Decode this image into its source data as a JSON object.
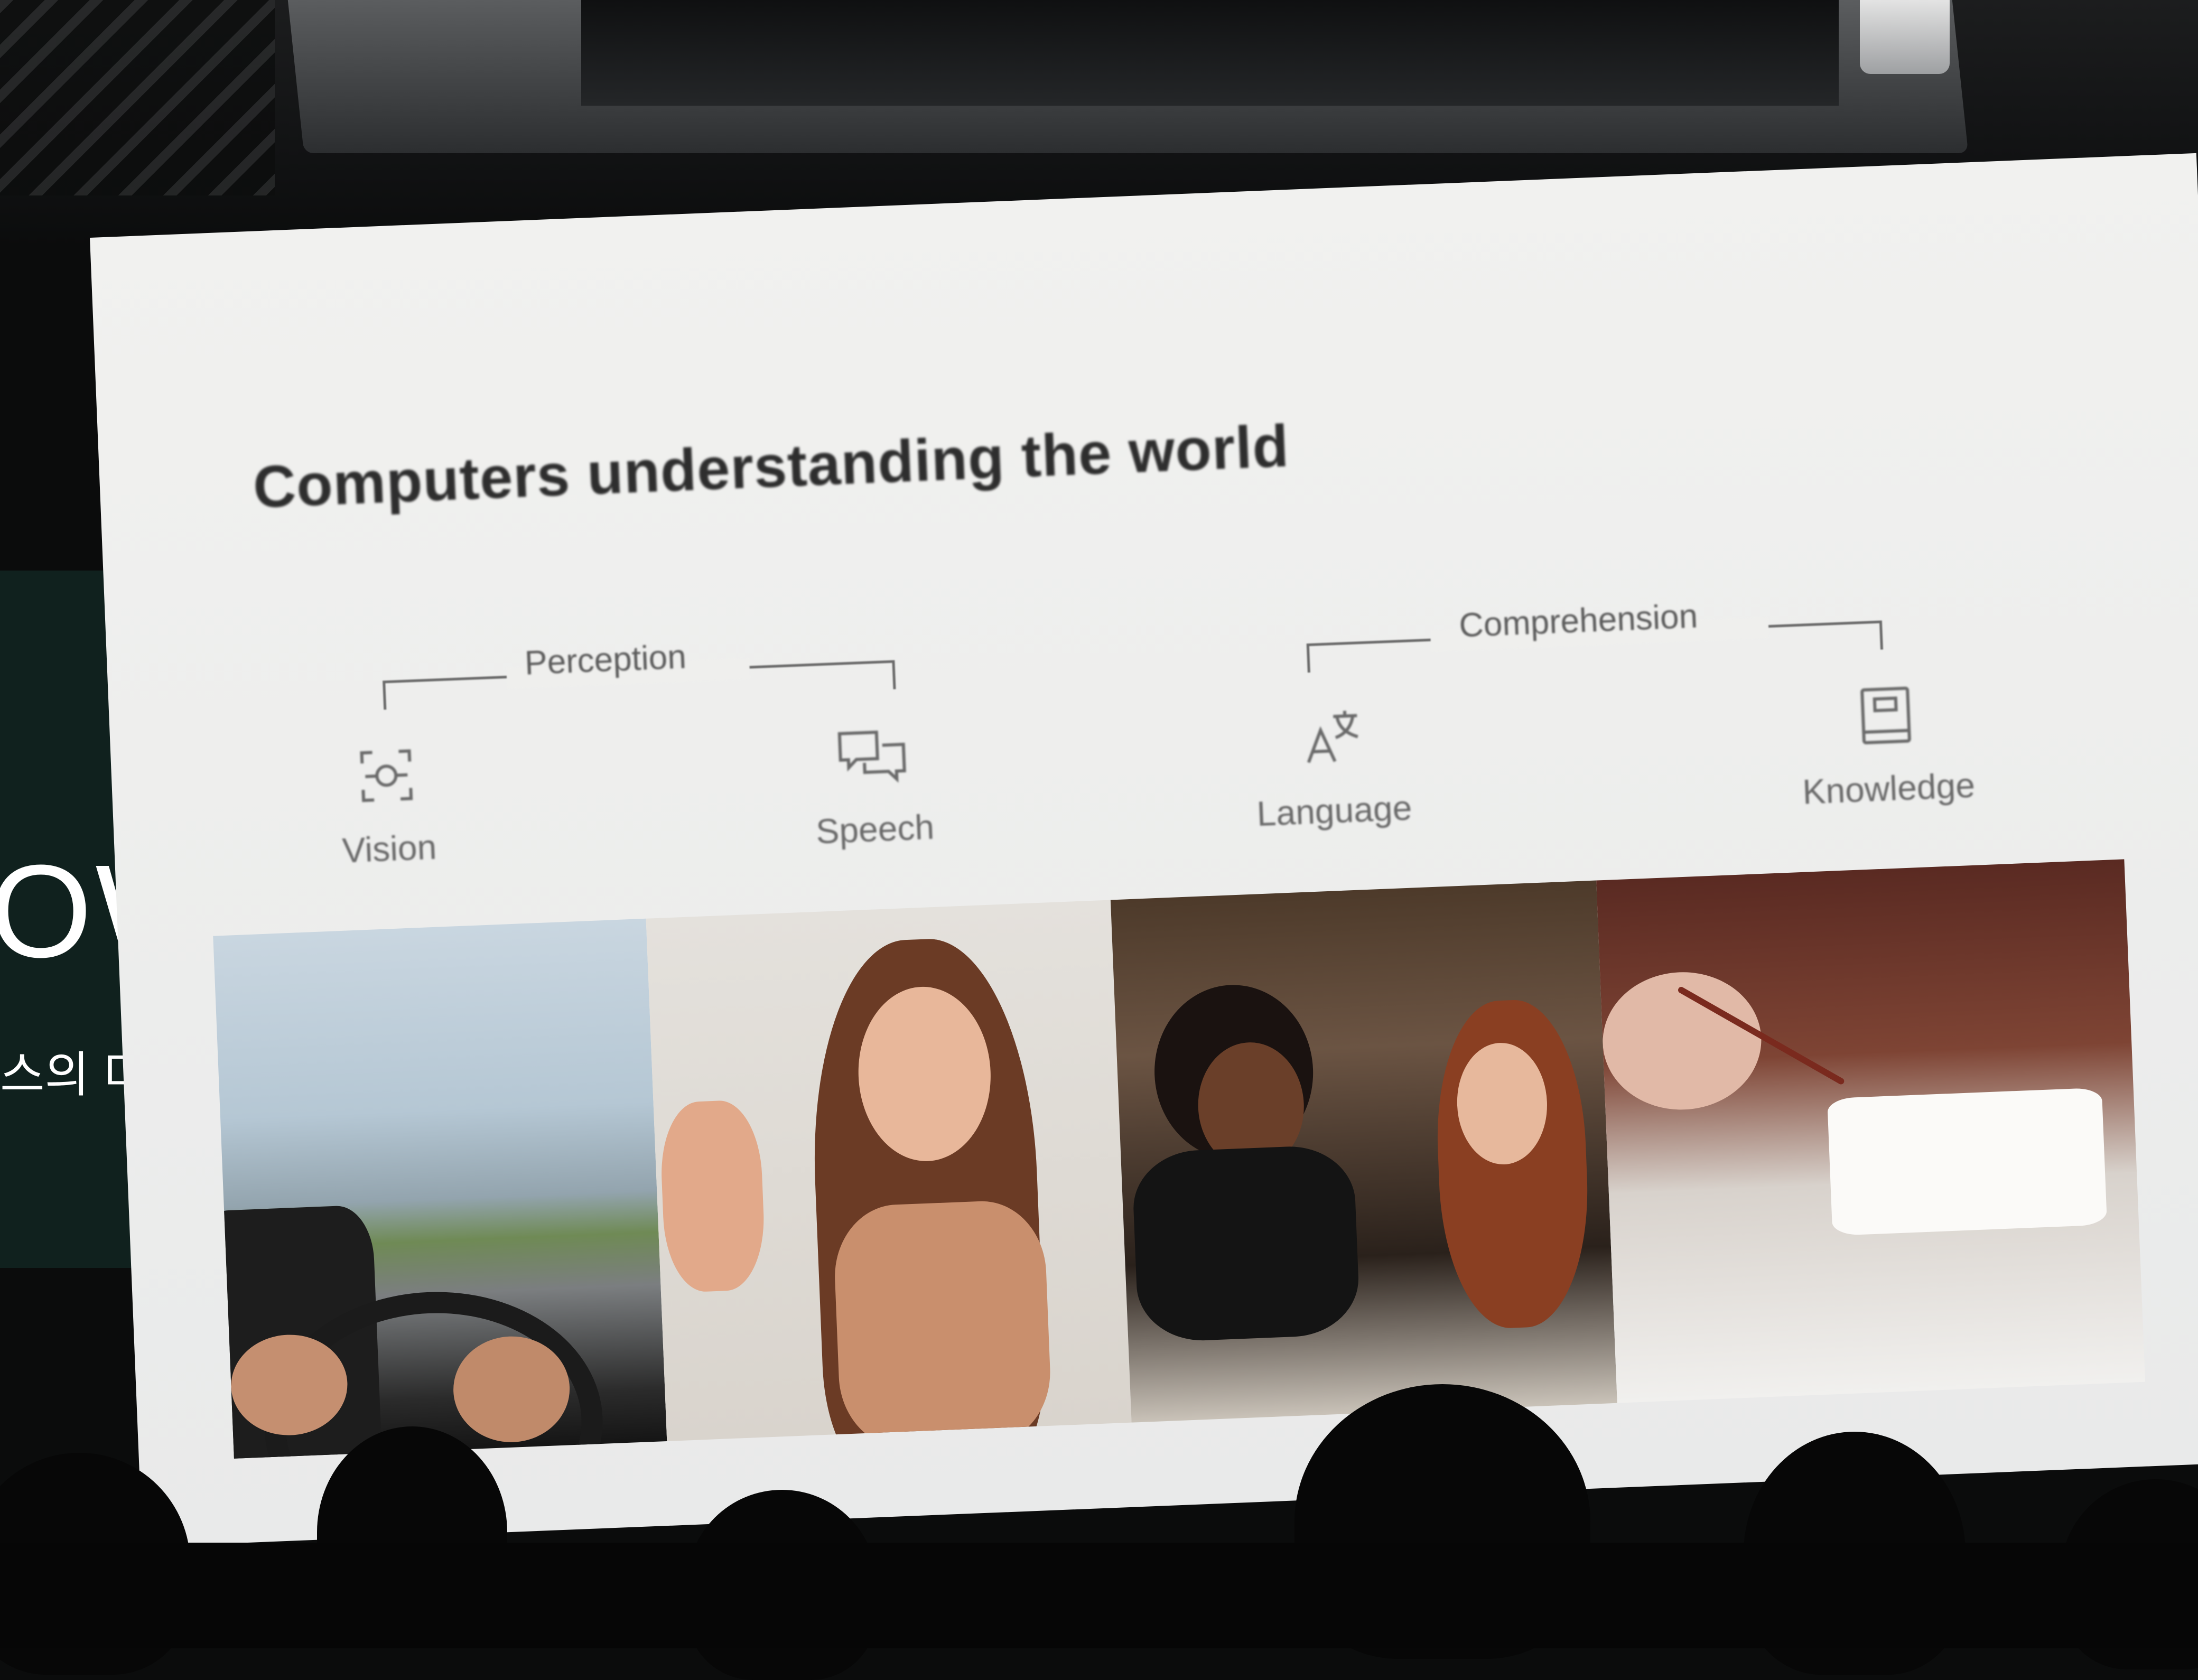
{
  "venue": {
    "side_screen_text": "OW",
    "side_screen_subtext": "스의 미"
  },
  "slide": {
    "title": "Computers understanding the world",
    "groups": [
      {
        "label": "Perception"
      },
      {
        "label": "Comprehension"
      }
    ],
    "categories": [
      {
        "label": "Vision",
        "icon": "vision-scan-icon"
      },
      {
        "label": "Speech",
        "icon": "speech-bubbles-icon"
      },
      {
        "label": "Language",
        "icon": "translate-icon"
      },
      {
        "label": "Knowledge",
        "icon": "book-icon"
      }
    ],
    "photos": [
      {
        "subject": "driving-photo"
      },
      {
        "subject": "woman-waving-photo"
      },
      {
        "subject": "two-women-talking-photo"
      },
      {
        "subject": "hand-writing-photo"
      }
    ]
  },
  "colors": {
    "slide_background": "#efefed",
    "title_text": "#2e2e2e",
    "label_text": "#6a6a6a",
    "side_panel": "#10211e"
  }
}
